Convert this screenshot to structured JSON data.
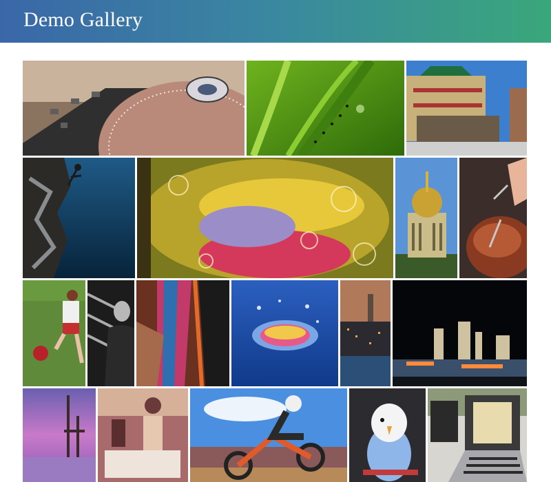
{
  "header": {
    "title": "Demo Gallery",
    "colors": {
      "left": "#3a67a8",
      "right": "#3aa77a"
    }
  },
  "gallery": {
    "photos": [
      {
        "id": "turntable",
        "icon": "turntable-photo"
      },
      {
        "id": "grass-ants",
        "icon": "grass-photo"
      },
      {
        "id": "chinatown",
        "icon": "pagoda-photo"
      },
      {
        "id": "climber",
        "icon": "climber-photo"
      },
      {
        "id": "oil-water",
        "icon": "bubbles-photo"
      },
      {
        "id": "dome",
        "icon": "dome-photo"
      },
      {
        "id": "steak",
        "icon": "steak-photo"
      },
      {
        "id": "soccer",
        "icon": "soccer-photo"
      },
      {
        "id": "portrait-man",
        "icon": "portrait-photo"
      },
      {
        "id": "textile",
        "icon": "textile-photo"
      },
      {
        "id": "water-drop",
        "icon": "splash-photo"
      },
      {
        "id": "skyline",
        "icon": "skyline-photo"
      },
      {
        "id": "vegas-night",
        "icon": "city-night-photo"
      },
      {
        "id": "sunset-lake",
        "icon": "sunset-photo"
      },
      {
        "id": "vintage-woman",
        "icon": "vintage-photo"
      },
      {
        "id": "motocross",
        "icon": "motocross-photo"
      },
      {
        "id": "parakeet",
        "icon": "parakeet-photo"
      },
      {
        "id": "laptops",
        "icon": "laptop-photo"
      }
    ]
  }
}
